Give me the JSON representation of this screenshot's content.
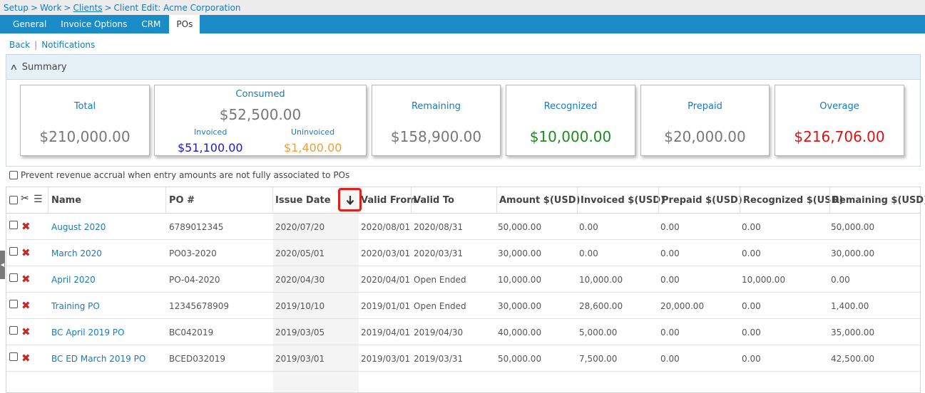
{
  "breadcrumb": {
    "setup": "Setup",
    "work": "Work",
    "clients": "Clients",
    "current": "Client Edit: Acme Corporation",
    "separator": ">"
  },
  "tabs": [
    "General",
    "Invoice Options",
    "CRM",
    "POs"
  ],
  "active_tab": "POs",
  "subnav": {
    "back": "Back",
    "notifications": "Notifications"
  },
  "summary": {
    "title": "Summary",
    "total": {
      "label": "Total",
      "value": "$210,000.00"
    },
    "consumed": {
      "label": "Consumed",
      "value": "$52,500.00",
      "invoiced_label": "Invoiced",
      "invoiced_value": "$51,100.00",
      "uninvoiced_label": "Uninvoiced",
      "uninvoiced_value": "$1,400.00"
    },
    "remaining": {
      "label": "Remaining",
      "value": "$158,900.00"
    },
    "recognized": {
      "label": "Recognized",
      "value": "$10,000.00"
    },
    "prepaid": {
      "label": "Prepaid",
      "value": "$20,000.00"
    },
    "overage": {
      "label": "Overage",
      "value": "$216,706.00"
    },
    "colors": {
      "label": "#1a7ab8",
      "neutral": "#777777",
      "invoiced": "#1a1acc",
      "uninvoiced": "#f0a030",
      "recognized": "#1e8a1e",
      "overage": "#e01010"
    }
  },
  "prevent_label": "Prevent revenue accrual when entry amounts are not fully associated to POs",
  "grid": {
    "headers": {
      "name": "Name",
      "po": "PO #",
      "issue_date": "Issue Date",
      "valid_from": "Valid From",
      "valid_to": "Valid To",
      "amount": "Amount $(USD)",
      "invoiced": "Invoiced $(USD)",
      "prepaid": "Prepaid $(USD)",
      "recognized": "Recognized $(USD)",
      "remaining": "Remaining $(USD)"
    },
    "sort_icon": "arrow-down-icon",
    "rows": [
      {
        "name": "August 2020",
        "po": "6789012345",
        "issue_date": "2020/07/20",
        "valid_from": "2020/08/01",
        "valid_to": "2020/08/31",
        "amount": "50,000.00",
        "invoiced": "0.00",
        "prepaid": "0.00",
        "recognized": "0.00",
        "remaining": "50,000.00"
      },
      {
        "name": "March 2020",
        "po": "PO03-2020",
        "issue_date": "2020/05/01",
        "valid_from": "2020/03/01",
        "valid_to": "2020/03/31",
        "amount": "30,000.00",
        "invoiced": "0.00",
        "prepaid": "0.00",
        "recognized": "0.00",
        "remaining": "30,000.00"
      },
      {
        "name": "April 2020",
        "po": "PO-04-2020",
        "issue_date": "2020/04/30",
        "valid_from": "2020/04/01",
        "valid_to": "Open Ended",
        "amount": "10,000.00",
        "invoiced": "10,000.00",
        "prepaid": "0.00",
        "recognized": "10,000.00",
        "remaining": "0.00"
      },
      {
        "name": "Training PO",
        "po": "12345678909",
        "issue_date": "2019/10/10",
        "valid_from": "2019/01/01",
        "valid_to": "Open Ended",
        "amount": "30,000.00",
        "invoiced": "28,600.00",
        "prepaid": "20,000.00",
        "recognized": "0.00",
        "remaining": "1,400.00"
      },
      {
        "name": "BC April 2019 PO",
        "po": "BC042019",
        "issue_date": "2019/03/05",
        "valid_from": "2019/04/01",
        "valid_to": "2019/04/30",
        "amount": "40,000.00",
        "invoiced": "5,000.00",
        "prepaid": "0.00",
        "recognized": "0.00",
        "remaining": "35,000.00"
      },
      {
        "name": "BC ED March 2019 PO",
        "po": "BCED032019",
        "issue_date": "2019/03/01",
        "valid_from": "2019/03/01",
        "valid_to": "2019/03/31",
        "amount": "50,000.00",
        "invoiced": "7,500.00",
        "prepaid": "0.00",
        "recognized": "0.00",
        "remaining": "42,500.00"
      }
    ]
  }
}
